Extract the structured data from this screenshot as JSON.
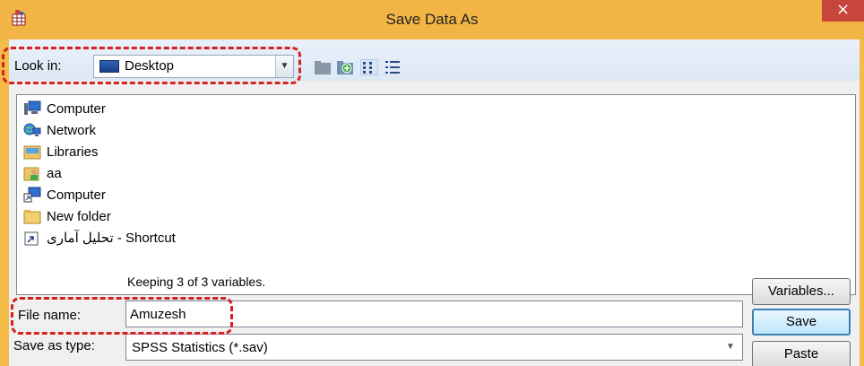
{
  "window": {
    "title": "Save Data As",
    "close_glyph": "×",
    "app_icon": "spss-data-icon"
  },
  "toolbar": {
    "lookin_label": "Look in:",
    "lookin_value": "Desktop",
    "icons": [
      "up-folder-icon",
      "new-folder-icon",
      "list-view-icon",
      "details-view-icon"
    ]
  },
  "files": [
    {
      "name": "Computer",
      "icon": "computer-icon"
    },
    {
      "name": "Network",
      "icon": "network-icon"
    },
    {
      "name": "Libraries",
      "icon": "libraries-icon"
    },
    {
      "name": "aa",
      "icon": "user-folder-icon"
    },
    {
      "name": "Computer",
      "icon": "computer-shortcut-icon"
    },
    {
      "name": "New folder",
      "icon": "folder-icon"
    },
    {
      "name": "تحلیل آماری - Shortcut",
      "icon": "shortcut-icon"
    }
  ],
  "status": {
    "keeping": "Keeping 3 of 3 variables."
  },
  "form": {
    "file_name_label": "File name:",
    "file_name_value": "Amuzesh",
    "save_type_label": "Save as type:",
    "save_type_value": "SPSS Statistics (*.sav)"
  },
  "buttons": {
    "variables": "Variables...",
    "save": "Save",
    "paste": "Paste"
  },
  "colors": {
    "titlebar": "#f2b545",
    "close": "#c7453a",
    "highlight": "#d62020"
  }
}
